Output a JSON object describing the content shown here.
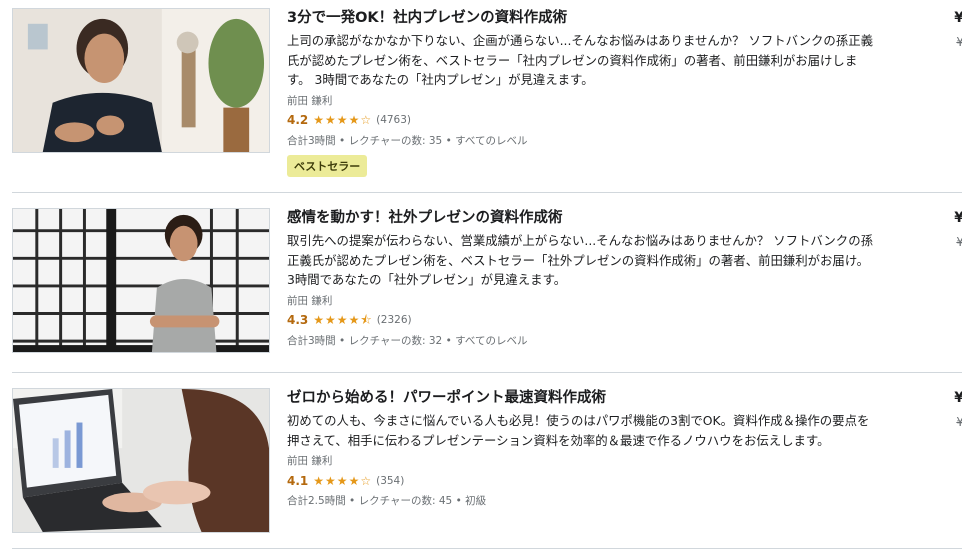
{
  "courses": [
    {
      "title": "3分で一発OK！社内プレゼンの資料作成術",
      "description": "上司の承認がなかなか下りない、企画が通らない...そんなお悩みはありませんか？ ソフトバンクの孫正義氏が認めたプレゼン術を、ベストセラー「社内プレゼンの資料作成術」の著者、前田鎌利がお届けします。 3時間であなたの「社内プレゼン」が見違えます。",
      "author": "前田 鎌利",
      "rating": "4.2",
      "stars": 4.2,
      "review_count": "(4763)",
      "hours": "合計3時間",
      "lectures": "レクチャーの数: 35",
      "level": "すべてのレベル",
      "badge": "ベストセラー",
      "price_symbol": "¥",
      "orig_price_symbol": "¥"
    },
    {
      "title": "感情を動かす！社外プレゼンの資料作成術",
      "description": "取引先への提案が伝わらない、営業成績が上がらない...そんなお悩みはありませんか？ ソフトバンクの孫正義氏が認めたプレゼン術を、ベストセラー「社外プレゼンの資料作成術」の著者、前田鎌利がお届け。 3時間であなたの「社外プレゼン」が見違えます。",
      "author": "前田 鎌利",
      "rating": "4.3",
      "stars": 4.3,
      "review_count": "(2326)",
      "hours": "合計3時間",
      "lectures": "レクチャーの数: 32",
      "level": "すべてのレベル",
      "price_symbol": "¥",
      "orig_price_symbol": "¥"
    },
    {
      "title": "ゼロから始める！パワーポイント最速資料作成術",
      "description": "初めての人も、今まさに悩んでいる人も必見！使うのはパワポ機能の3割でOK。資料作成＆操作の要点を押さえて、相手に伝わるプレゼンテーション資料を効率的＆最速で作るノウハウをお伝えします。",
      "author": "前田 鎌利",
      "rating": "4.1",
      "stars": 4.1,
      "review_count": "(354)",
      "hours": "合計2.5時間",
      "lectures": "レクチャーの数: 45",
      "level": "初級",
      "price_symbol": "¥",
      "orig_price_symbol": "¥"
    }
  ],
  "meta_separator": "•",
  "colors": {
    "rating": "#b4690e",
    "star": "#e59819",
    "badge_bg": "#eceb98",
    "muted": "#6a6f73"
  }
}
